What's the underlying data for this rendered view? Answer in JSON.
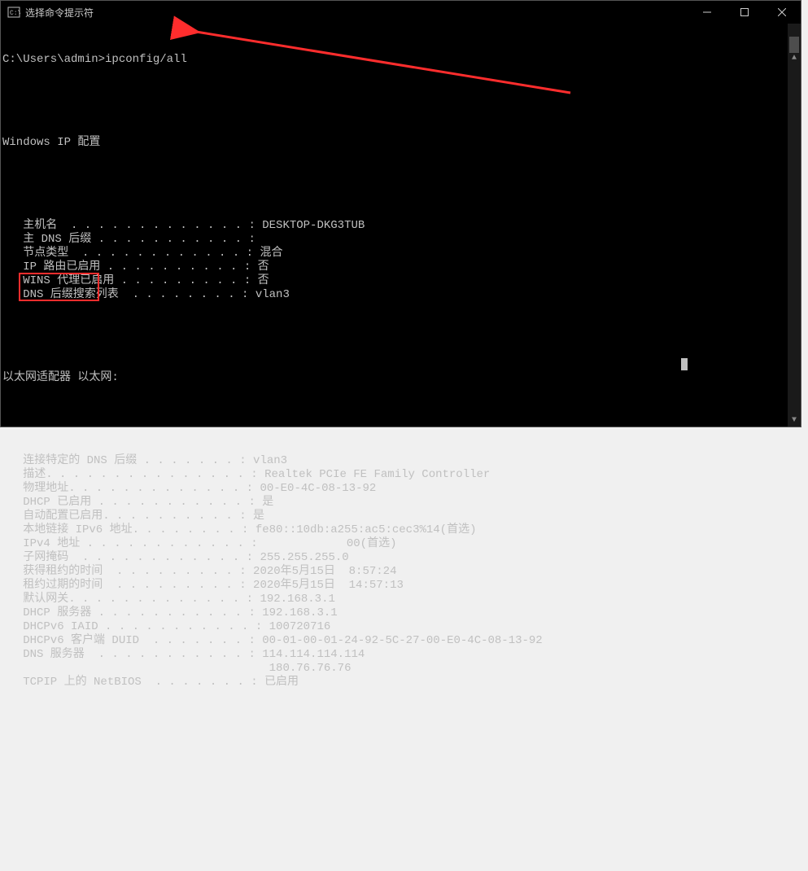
{
  "titlebar": {
    "icon_name": "cmd-icon",
    "title": "选择命令提示符"
  },
  "prompt": "C:\\Users\\admin>",
  "command": "ipconfig/all",
  "section_header": "Windows IP 配置",
  "host_block": [
    {
      "label": "   主机名  . . . . . . . . . . . . . : ",
      "value": "DESKTOP-DKG3TUB"
    },
    {
      "label": "   主 DNS 后缀 . . . . . . . . . . . : ",
      "value": ""
    },
    {
      "label": "   节点类型  . . . . . . . . . . . . : ",
      "value": "混合"
    },
    {
      "label": "   IP 路由已启用 . . . . . . . . . . : ",
      "value": "否"
    },
    {
      "label": "   WINS 代理已启用 . . . . . . . . . : ",
      "value": "否"
    },
    {
      "label": "   DNS 后缀搜索列表  . . . . . . . . : ",
      "value": "vlan3"
    }
  ],
  "adapter_header": "以太网适配器 以太网:",
  "adapter_block": [
    {
      "label": "   连接特定的 DNS 后缀 . . . . . . . : ",
      "value": "vlan3"
    },
    {
      "label": "   描述. . . . . . . . . . . . . . . : ",
      "value": "Realtek PCIe FE Family Controller"
    },
    {
      "label": "   物理地址. . . . . . . . . . . . . : ",
      "value": "00-E0-4C-08-13-92"
    },
    {
      "label": "   DHCP 已启用 . . . . . . . . . . . : ",
      "value": "是"
    },
    {
      "label": "   自动配置已启用. . . . . . . . . . : ",
      "value": "是"
    },
    {
      "label": "   本地链接 IPv6 地址. . . . . . . . : ",
      "value": "fe80::10db:a255:ac5:cec3%14(首选)"
    },
    {
      "label": "   IPv4 地址 . . . . . . . . . . . . : ",
      "value": "            00(首选)",
      "hl": true
    },
    {
      "label": "   子网掩码  . . . . . . . . . . . . : ",
      "value": "255.255.255.0"
    },
    {
      "label": "   获得租约的时间  . . . . . . . . . : ",
      "value": "2020年5月15日  8:57:24"
    },
    {
      "label": "   租约过期的时间  . . . . . . . . . : ",
      "value": "2020年5月15日  14:57:13"
    },
    {
      "label": "   默认网关. . . . . . . . . . . . . : ",
      "value": "192.168.3.1"
    },
    {
      "label": "   DHCP 服务器 . . . . . . . . . . . : ",
      "value": "192.168.3.1"
    },
    {
      "label": "   DHCPv6 IAID . . . . . . . . . . . : ",
      "value": "100720716"
    },
    {
      "label": "   DHCPv6 客户端 DUID  . . . . . . . : ",
      "value": "00-01-00-01-24-92-5C-27-00-E0-4C-08-13-92"
    },
    {
      "label": "   DNS 服务器  . . . . . . . . . . . : ",
      "value": "114.114.114.114"
    },
    {
      "label": "                                       ",
      "value": "180.76.76.76"
    },
    {
      "label": "   TCPIP 上的 NetBIOS  . . . . . . . : ",
      "value": "已启用"
    }
  ]
}
